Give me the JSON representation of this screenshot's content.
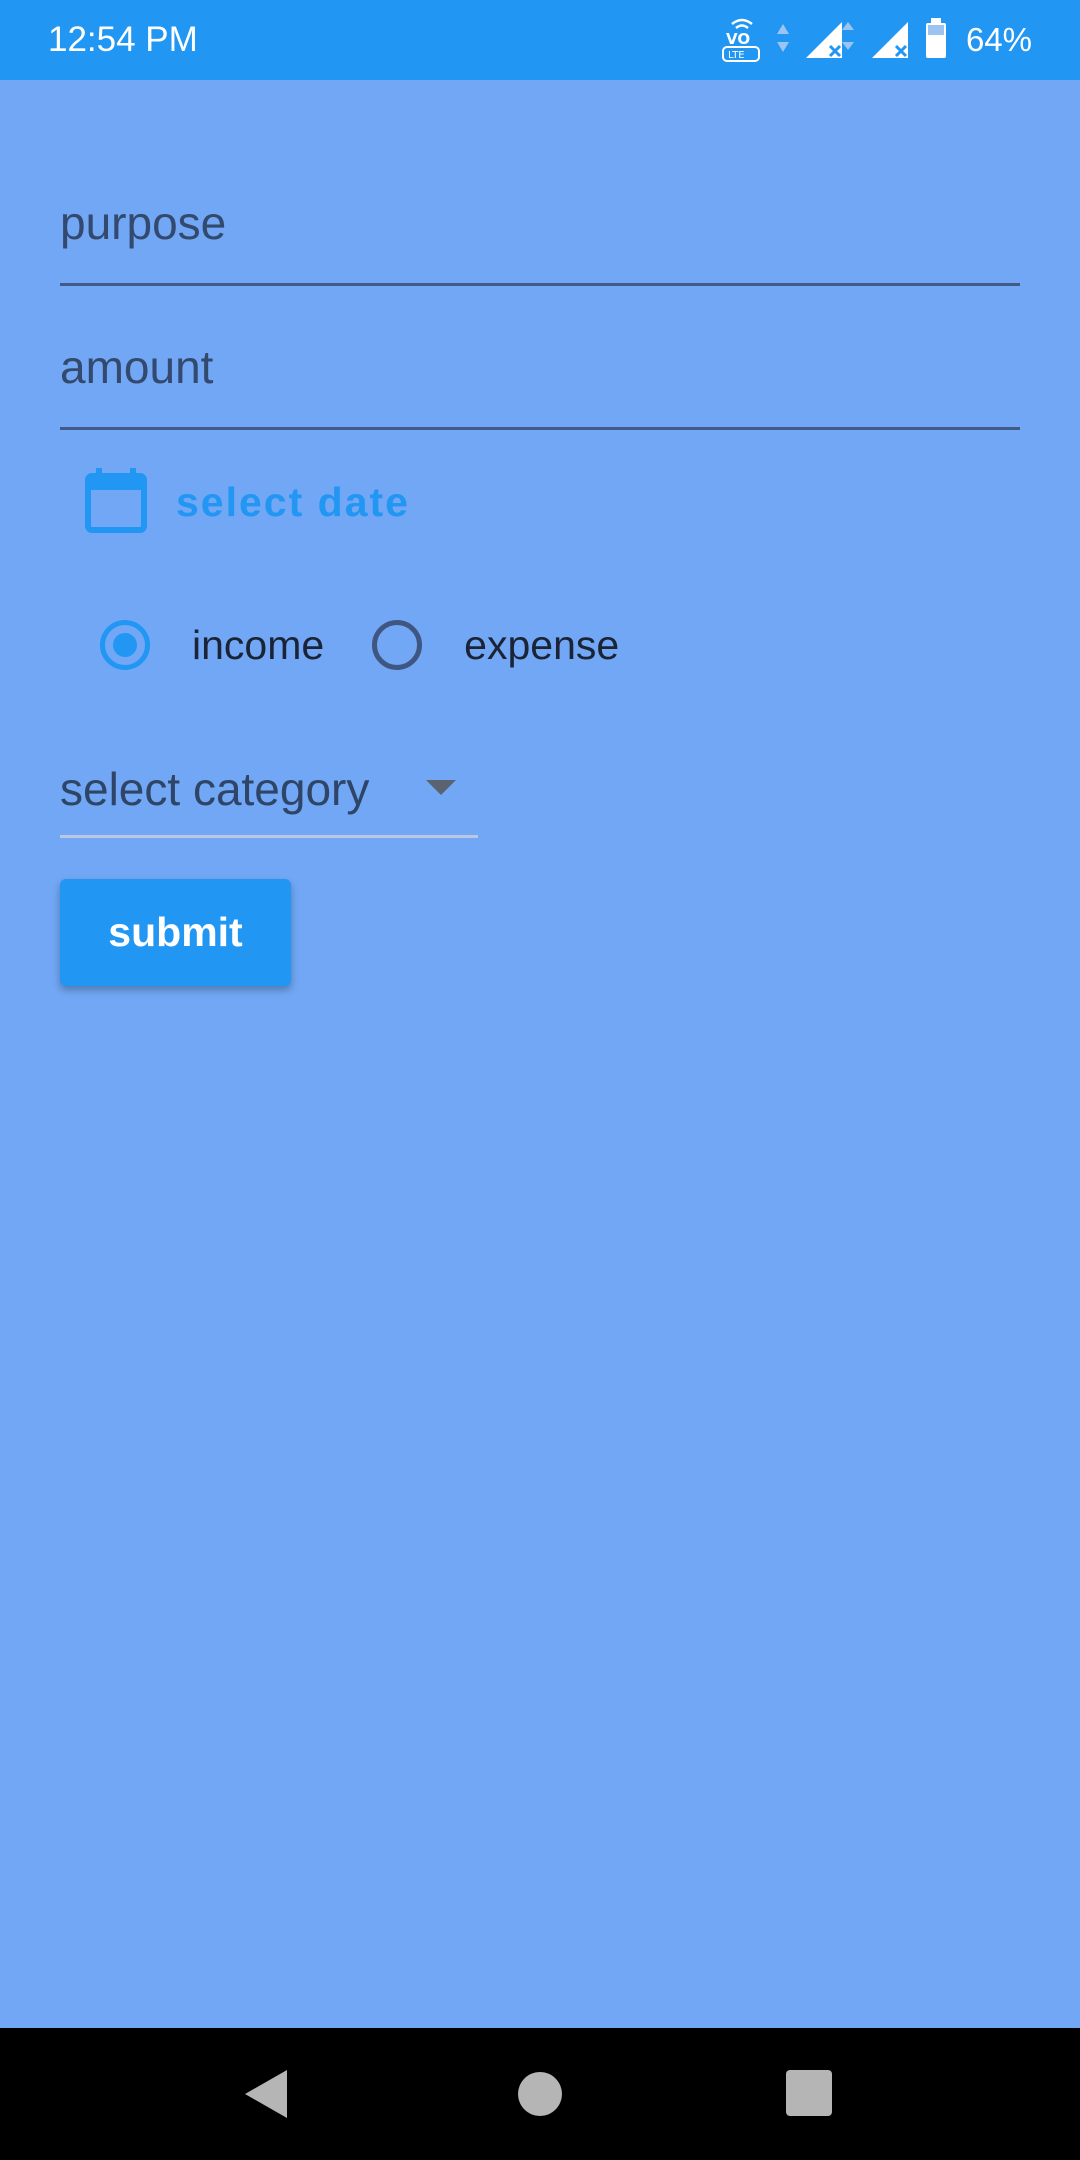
{
  "status_bar": {
    "time": "12:54 PM",
    "battery": "64%",
    "icons": [
      "volte-icon",
      "signal-icon",
      "signal-icon",
      "battery-icon"
    ],
    "volte_label": "VO",
    "volte_sub": "LTE"
  },
  "form": {
    "purpose_placeholder": "purpose",
    "amount_placeholder": "amount",
    "date_label": "select date",
    "date_icon": "calendar-icon",
    "radio_income": "income",
    "radio_expense": "expense",
    "selected_type": "income",
    "category_value": "select category",
    "submit_label": "submit"
  },
  "colors": {
    "background": "#71a7f4",
    "accent": "#2196f3",
    "status_bar": "#2196f3",
    "nav_bar": "#000000"
  },
  "nav_bar": {
    "icons": [
      "back-icon",
      "home-icon",
      "recents-icon"
    ]
  }
}
